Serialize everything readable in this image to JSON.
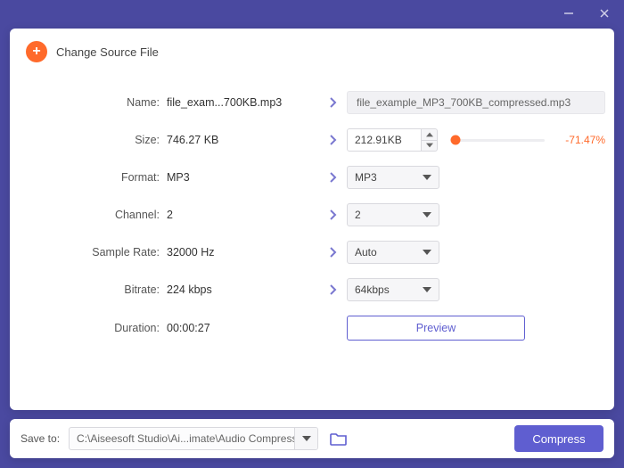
{
  "header": {
    "change_source": "Change Source File"
  },
  "fields": {
    "name_label": "Name:",
    "name_value": "file_exam...700KB.mp3",
    "name_out": "file_example_MP3_700KB_compressed.mp3",
    "size_label": "Size:",
    "size_value": "746.27 KB",
    "size_out": "212.91KB",
    "size_pct": "-71.47%",
    "format_label": "Format:",
    "format_value": "MP3",
    "format_out": "MP3",
    "channel_label": "Channel:",
    "channel_value": "2",
    "channel_out": "2",
    "samplerate_label": "Sample Rate:",
    "samplerate_value": "32000 Hz",
    "samplerate_out": "Auto",
    "bitrate_label": "Bitrate:",
    "bitrate_value": "224 kbps",
    "bitrate_out": "64kbps",
    "duration_label": "Duration:",
    "duration_value": "00:00:27",
    "preview": "Preview"
  },
  "footer": {
    "save_to": "Save to:",
    "path": "C:\\Aiseesoft Studio\\Ai...imate\\Audio Compressed",
    "compress": "Compress"
  }
}
